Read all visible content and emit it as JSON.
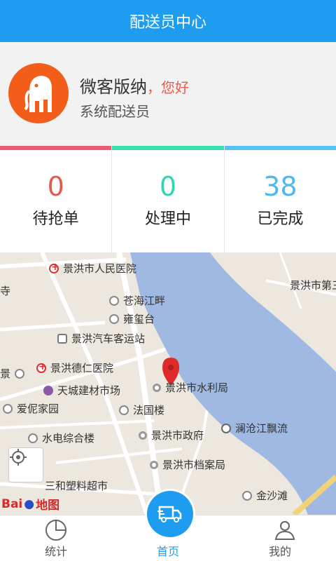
{
  "header": {
    "title": "配送员中心"
  },
  "profile": {
    "name": "微客版纳",
    "greeting": "，您好",
    "role": "系统配送员",
    "avatar_bg": "#f25d1a"
  },
  "stats": [
    {
      "value": "0",
      "label": "待抢单",
      "color": "#e8594a",
      "bar_color": "#ea5e75"
    },
    {
      "value": "0",
      "label": "处理中",
      "color": "#2fd6b4",
      "bar_color": "#38dfb5"
    },
    {
      "value": "38",
      "label": "已完成",
      "color": "#4fb8ef",
      "bar_color": "#57c3f5"
    }
  ],
  "map": {
    "pois": [
      {
        "name": "景洪市人民医院",
        "kind": "hosp"
      },
      {
        "name": "景洪市第三",
        "kind": "none"
      },
      {
        "name": "苍海江畔",
        "kind": "bld"
      },
      {
        "name": "雍玺台",
        "kind": "bld"
      },
      {
        "name": "景洪汽车客运站",
        "kind": "bus"
      },
      {
        "name": "景洪德仁医院",
        "kind": "hosp"
      },
      {
        "name": "天城建材市场",
        "kind": "shop"
      },
      {
        "name": "景洪市水利局",
        "kind": "gov"
      },
      {
        "name": "爱伲家园",
        "kind": "bld"
      },
      {
        "name": "法国楼",
        "kind": "bld"
      },
      {
        "name": "澜沧江飘流",
        "kind": "spot"
      },
      {
        "name": "水电综合楼",
        "kind": "bld"
      },
      {
        "name": "景洪市政府",
        "kind": "gov"
      },
      {
        "name": "景洪市档案局",
        "kind": "gov"
      },
      {
        "name": "三和塑料超市",
        "kind": "none"
      },
      {
        "name": "金沙滩",
        "kind": "bld"
      },
      {
        "name": "寺",
        "kind": "none"
      },
      {
        "name": "景",
        "kind": "bld"
      }
    ],
    "logo_bai": "Bai",
    "logo_du": "地图"
  },
  "tabbar": {
    "items": [
      {
        "label": "统计"
      },
      {
        "label": "首页"
      },
      {
        "label": "我的"
      }
    ]
  }
}
